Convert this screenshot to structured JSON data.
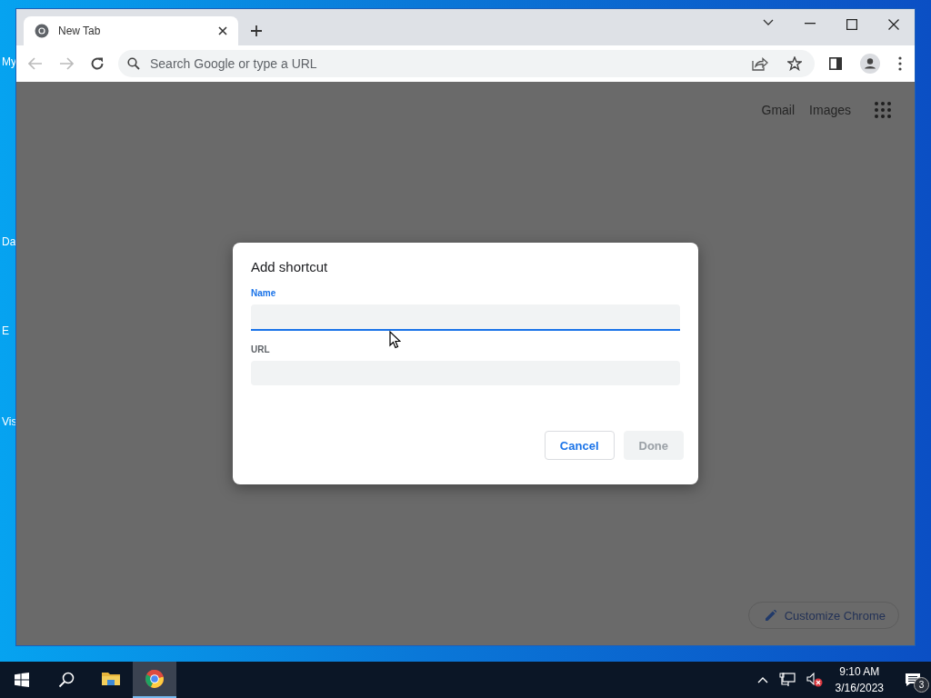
{
  "desktop_icons": [
    {
      "label": "My"
    },
    {
      "label": "Da"
    },
    {
      "label": "E"
    },
    {
      "label": "Vis"
    }
  ],
  "browser": {
    "tabs": [
      {
        "title": "New Tab",
        "selected": true
      }
    ],
    "omnibox": {
      "placeholder": "Search Google or type a URL"
    },
    "page": {
      "links": [
        "Gmail",
        "Images"
      ],
      "customize_button": "Customize Chrome"
    }
  },
  "dialog": {
    "title": "Add shortcut",
    "fields": [
      {
        "label": "Name",
        "focused": true
      },
      {
        "label": "URL",
        "focused": false
      }
    ],
    "buttons": [
      {
        "label": "Cancel",
        "disabled": false
      },
      {
        "label": "Done",
        "disabled": true
      }
    ]
  },
  "taskbar": {
    "apps": [
      {
        "kind": "explorer",
        "active": false
      },
      {
        "kind": "chrome",
        "active": true
      }
    ],
    "clock": {
      "time": "9:10 AM",
      "date": "3/16/2023"
    },
    "notifications": "3"
  }
}
